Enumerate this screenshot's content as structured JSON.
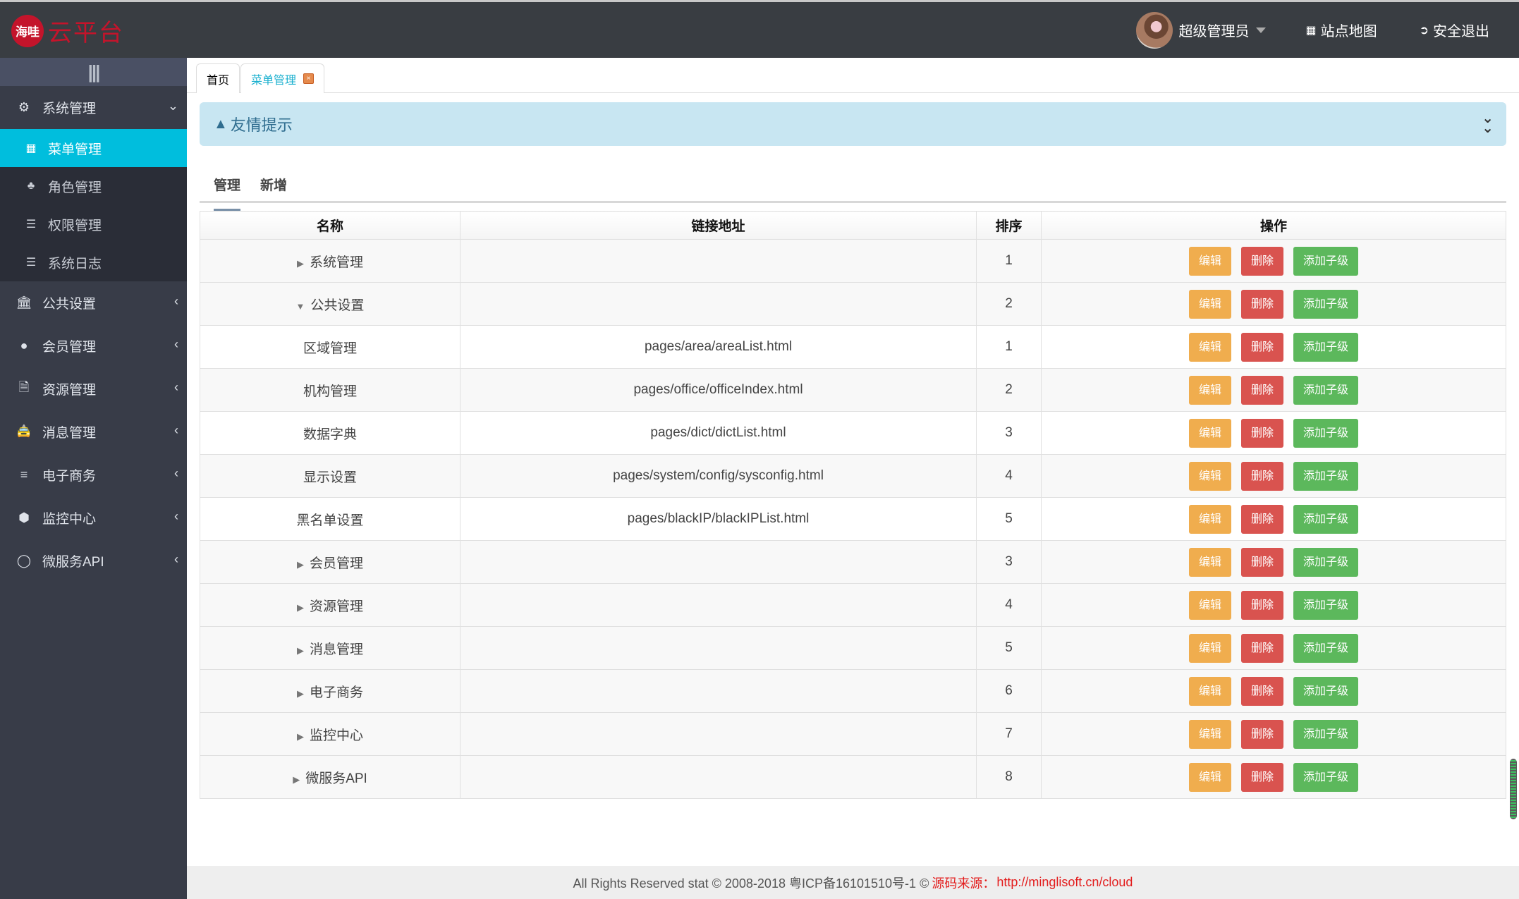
{
  "brand": {
    "badge": "海哇",
    "title": "云平台",
    "color": "#c4142b"
  },
  "topnav": {
    "user": "超级管理员",
    "sitemap": "站点地图",
    "logout": "安全退出"
  },
  "sidebar": {
    "collapse_icon": "|||",
    "groups": [
      {
        "label": "系统管理",
        "icon": "gears-icon",
        "expanded": true,
        "items": [
          {
            "label": "菜单管理",
            "icon": "windows-icon",
            "active": true
          },
          {
            "label": "角色管理",
            "icon": "cubes-icon"
          },
          {
            "label": "权限管理",
            "icon": "list-icon"
          },
          {
            "label": "系统日志",
            "icon": "list-icon"
          }
        ]
      },
      {
        "label": "公共设置",
        "icon": "bank-icon"
      },
      {
        "label": "会员管理",
        "icon": "user-icon"
      },
      {
        "label": "资源管理",
        "icon": "file-code-icon"
      },
      {
        "label": "消息管理",
        "icon": "taxi-icon"
      },
      {
        "label": "电子商务",
        "icon": "sliders-icon"
      },
      {
        "label": "监控中心",
        "icon": "cube-icon"
      },
      {
        "label": "微服务API",
        "icon": "circle-notch-icon"
      }
    ]
  },
  "tabs": [
    {
      "label": "首页"
    },
    {
      "label": "菜单管理",
      "active": true
    }
  ],
  "alert": {
    "title": "友情提示"
  },
  "subtabs": [
    {
      "label": "管理",
      "active": true
    },
    {
      "label": "新增"
    }
  ],
  "table": {
    "columns": [
      "名称",
      "链接地址",
      "排序",
      "操作"
    ],
    "actions": {
      "edit": "编辑",
      "delete": "删除",
      "add_child": "添加子级"
    },
    "rows": [
      {
        "name": "系统管理",
        "link": "",
        "sort": "1",
        "toggle": "collapsed",
        "level": 0
      },
      {
        "name": "公共设置",
        "link": "",
        "sort": "2",
        "toggle": "expanded",
        "level": 0
      },
      {
        "name": "区域管理",
        "link": "pages/area/areaList.html",
        "sort": "1",
        "level": 1
      },
      {
        "name": "机构管理",
        "link": "pages/office/officeIndex.html",
        "sort": "2",
        "level": 1
      },
      {
        "name": "数据字典",
        "link": "pages/dict/dictList.html",
        "sort": "3",
        "level": 1
      },
      {
        "name": "显示设置",
        "link": "pages/system/config/sysconfig.html",
        "sort": "4",
        "level": 1
      },
      {
        "name": "黑名单设置",
        "link": "pages/blackIP/blackIPList.html",
        "sort": "5",
        "level": 1
      },
      {
        "name": "会员管理",
        "link": "",
        "sort": "3",
        "toggle": "collapsed",
        "level": 0
      },
      {
        "name": "资源管理",
        "link": "",
        "sort": "4",
        "toggle": "collapsed",
        "level": 0
      },
      {
        "name": "消息管理",
        "link": "",
        "sort": "5",
        "toggle": "collapsed",
        "level": 0
      },
      {
        "name": "电子商务",
        "link": "",
        "sort": "6",
        "toggle": "collapsed",
        "level": 0
      },
      {
        "name": "监控中心",
        "link": "",
        "sort": "7",
        "toggle": "collapsed",
        "level": 0
      },
      {
        "name": "微服务API",
        "link": "",
        "sort": "8",
        "toggle": "collapsed",
        "level": 0
      }
    ]
  },
  "footer": {
    "text": "All Rights Reserved stat © 2008-2018 粤ICP备16101510号-1 ©",
    "source_label": "源码来源：",
    "source_url": "http://minglisoft.cn/cloud"
  }
}
